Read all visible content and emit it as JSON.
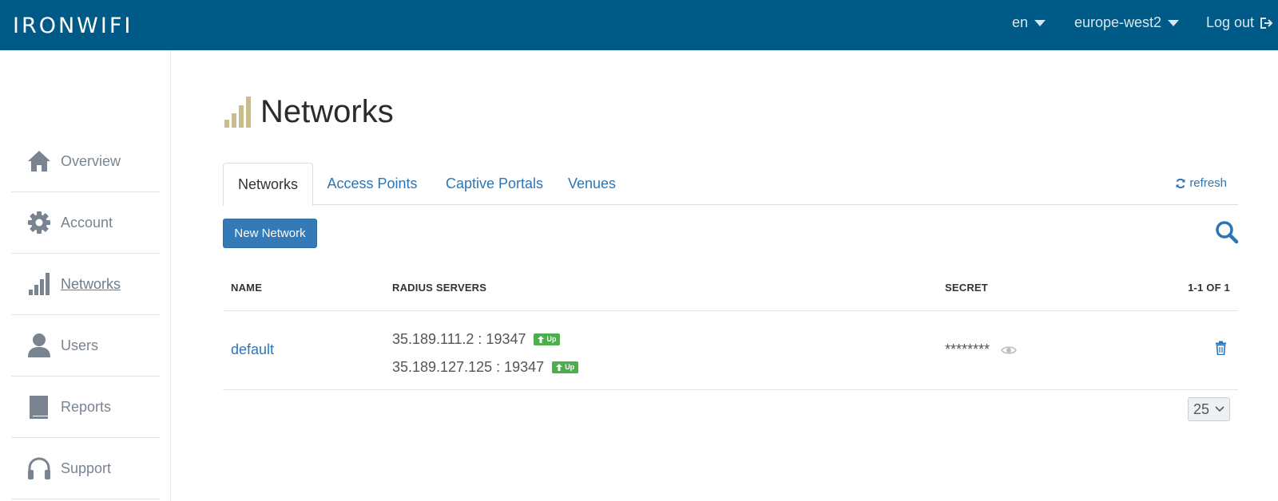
{
  "app": {
    "logo_text": "IRONWIFI",
    "brand_color": "#005a87"
  },
  "topbar": {
    "language": "en",
    "region": "europe-west2",
    "logout_label": "Log out"
  },
  "sidebar": {
    "items": [
      {
        "label": "Overview",
        "icon": "home-icon",
        "active": false
      },
      {
        "label": "Account",
        "icon": "gear-icon",
        "active": false
      },
      {
        "label": "Networks",
        "icon": "signal-bars-icon",
        "active": true
      },
      {
        "label": "Users",
        "icon": "user-icon",
        "active": false
      },
      {
        "label": "Reports",
        "icon": "book-icon",
        "active": false
      },
      {
        "label": "Support",
        "icon": "headphones-icon",
        "active": false
      }
    ]
  },
  "page": {
    "title": "Networks",
    "title_icon": "signal-bars-icon",
    "tabs": [
      {
        "label": "Networks",
        "active": true
      },
      {
        "label": "Access Points",
        "active": false
      },
      {
        "label": "Captive Portals",
        "active": false
      },
      {
        "label": "Venues",
        "active": false
      }
    ],
    "refresh_label": "refresh",
    "new_button_label": "New Network"
  },
  "table": {
    "headers": {
      "name": "NAME",
      "radius": "RADIUS SERVERS",
      "secret": "SECRET",
      "range": "1-1 OF 1"
    },
    "rows": [
      {
        "name": "default",
        "radius_servers": [
          {
            "address": "35.189.111.2 : 19347",
            "status": "Up"
          },
          {
            "address": "35.189.127.125 : 19347",
            "status": "Up"
          }
        ],
        "secret": "********"
      }
    ]
  },
  "pagination": {
    "page_size": "25"
  }
}
